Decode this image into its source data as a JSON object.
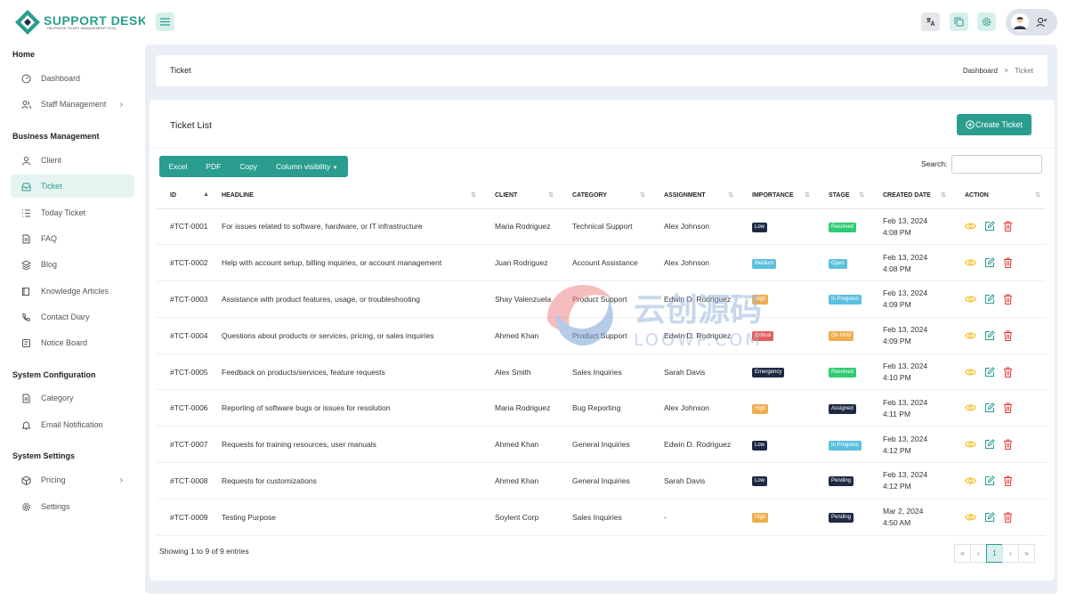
{
  "brand": {
    "name": "SUPPORT DESK",
    "tagline": "HELPDESK TICKET MANAGEMENT TOOL"
  },
  "sidebar": {
    "sections": [
      {
        "title": "Home",
        "items": [
          {
            "label": "Dashboard",
            "icon": "dashboard-icon"
          },
          {
            "label": "Staff Management",
            "icon": "users-icon",
            "chevron": true
          }
        ]
      },
      {
        "title": "Business Management",
        "items": [
          {
            "label": "Client",
            "icon": "user-icon"
          },
          {
            "label": "Ticket",
            "icon": "inbox-icon",
            "active": true
          },
          {
            "label": "Today Ticket",
            "icon": "list-icon"
          },
          {
            "label": "FAQ",
            "icon": "file-icon"
          },
          {
            "label": "Blog",
            "icon": "layers-icon"
          },
          {
            "label": "Knowledge Articles",
            "icon": "book-icon"
          },
          {
            "label": "Contact Diary",
            "icon": "phone-icon"
          },
          {
            "label": "Notice Board",
            "icon": "notice-icon"
          }
        ]
      },
      {
        "title": "System Configuration",
        "items": [
          {
            "label": "Category",
            "icon": "file-icon"
          },
          {
            "label": "Email Notification",
            "icon": "bell-icon"
          }
        ]
      },
      {
        "title": "System Settings",
        "items": [
          {
            "label": "Pricing",
            "icon": "package-icon",
            "chevron": true
          },
          {
            "label": "Settings",
            "icon": "gear-icon"
          }
        ]
      }
    ]
  },
  "breadcrumb": {
    "title": "Ticket",
    "home": "Dashboard",
    "separator": ">",
    "current": "Ticket"
  },
  "card": {
    "title": "Ticket List",
    "create_label": "Create Ticket"
  },
  "export_buttons": [
    "Excel",
    "PDF",
    "Copy",
    "Column visibility"
  ],
  "search": {
    "label": "Search:",
    "value": ""
  },
  "table": {
    "columns": [
      "ID",
      "HEADLINE",
      "CLIENT",
      "CATEGORY",
      "ASSIGNMENT",
      "IMPORTANCE",
      "STAGE",
      "CREATED DATE",
      "ACTION"
    ],
    "rows": [
      {
        "id": "#TCT-0001",
        "headline": "For issues related to software, hardware, or IT infrastructure",
        "client": "Maria Rodriguez",
        "category": "Technical Support",
        "assignment": "Alex Johnson",
        "importance": "Low",
        "imp_cls": "b-low",
        "stage": "Resolved",
        "stage_cls": "b-res",
        "date": "Feb 13, 2024",
        "time": "4:08 PM"
      },
      {
        "id": "#TCT-0002",
        "headline": "Help with account setup, billing inquiries, or account management",
        "client": "Juan Rodriguez",
        "category": "Account Assistance",
        "assignment": "Alex Johnson",
        "importance": "Medium",
        "imp_cls": "b-med",
        "stage": "Open",
        "stage_cls": "b-open",
        "date": "Feb 13, 2024",
        "time": "4:08 PM"
      },
      {
        "id": "#TCT-0003",
        "headline": "Assistance with product features, usage, or troubleshooting",
        "client": "Shay Valenzuela",
        "category": "Product Support",
        "assignment": "Edwin D. Rodriguez",
        "importance": "High",
        "imp_cls": "b-high",
        "stage": "In Progress",
        "stage_cls": "b-prog",
        "date": "Feb 13, 2024",
        "time": "4:09 PM"
      },
      {
        "id": "#TCT-0004",
        "headline": "Questions about products or services, pricing, or sales inquiries",
        "client": "Ahmed Khan",
        "category": "Product Support",
        "assignment": "Edwin D. Rodriguez",
        "importance": "Critical",
        "imp_cls": "b-crit",
        "stage": "On Hold",
        "stage_cls": "b-hold",
        "date": "Feb 13, 2024",
        "time": "4:09 PM"
      },
      {
        "id": "#TCT-0005",
        "headline": "Feedback on products/services, feature requests",
        "client": "Alex Smith",
        "category": "Sales Inquiries",
        "assignment": "Sarah Davis",
        "importance": "Emergency",
        "imp_cls": "b-emer",
        "stage": "Resolved",
        "stage_cls": "b-res",
        "date": "Feb 13, 2024",
        "time": "4:10 PM"
      },
      {
        "id": "#TCT-0006",
        "headline": "Reporting of software bugs or issues for resolution",
        "client": "Maria Rodriguez",
        "category": "Bug Reporting",
        "assignment": "Alex Johnson",
        "importance": "High",
        "imp_cls": "b-high",
        "stage": "Assigned",
        "stage_cls": "b-asg",
        "date": "Feb 13, 2024",
        "time": "4:11 PM"
      },
      {
        "id": "#TCT-0007",
        "headline": "Requests for training resources, user manuals",
        "client": "Ahmed Khan",
        "category": "General Inquiries",
        "assignment": "Edwin D. Rodriguez",
        "importance": "Low",
        "imp_cls": "b-low",
        "stage": "In Progress",
        "stage_cls": "b-prog",
        "date": "Feb 13, 2024",
        "time": "4:12 PM"
      },
      {
        "id": "#TCT-0008",
        "headline": "Requests for customizations",
        "client": "Ahmed Khan",
        "category": "General Inquiries",
        "assignment": "Sarah Davis",
        "importance": "Low",
        "imp_cls": "b-low",
        "stage": "Pending",
        "stage_cls": "b-pend",
        "date": "Feb 13, 2024",
        "time": "4:12 PM"
      },
      {
        "id": "#TCT-0009",
        "headline": "Testing Purpose",
        "client": "Soylent Corp",
        "category": "Sales Inquiries",
        "assignment": "-",
        "importance": "High",
        "imp_cls": "b-high",
        "stage": "Pending",
        "stage_cls": "b-pend",
        "date": "Mar 2, 2024",
        "time": "4:50 AM"
      }
    ]
  },
  "footer": {
    "info": "Showing 1 to 9 of 9 entries"
  },
  "pagination": [
    "«",
    "‹",
    "1",
    "›",
    "»"
  ],
  "watermark": {
    "text": "云创源码",
    "sub": "LOOWP.COM"
  },
  "colors": {
    "accent": "#2a9d8f",
    "danger": "#e53935",
    "warning": "#f5b400"
  }
}
